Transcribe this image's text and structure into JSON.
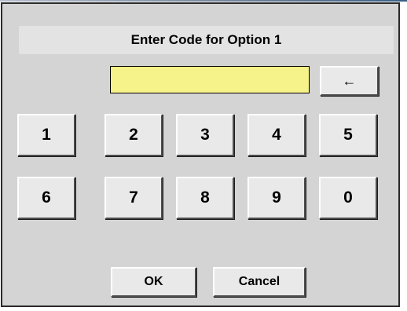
{
  "dialog": {
    "title": "Enter Code for Option 1",
    "code_value": ""
  },
  "keypad": {
    "backspace_label": "←",
    "row1": [
      "1",
      "2",
      "3",
      "4",
      "5"
    ],
    "row2": [
      "6",
      "7",
      "8",
      "9",
      "0"
    ]
  },
  "actions": {
    "ok_label": "OK",
    "cancel_label": "Cancel"
  },
  "colors": {
    "screen_background": "#d4d4d4",
    "code_field_background": "#f7f38b",
    "button_face": "#e9e9e9"
  }
}
